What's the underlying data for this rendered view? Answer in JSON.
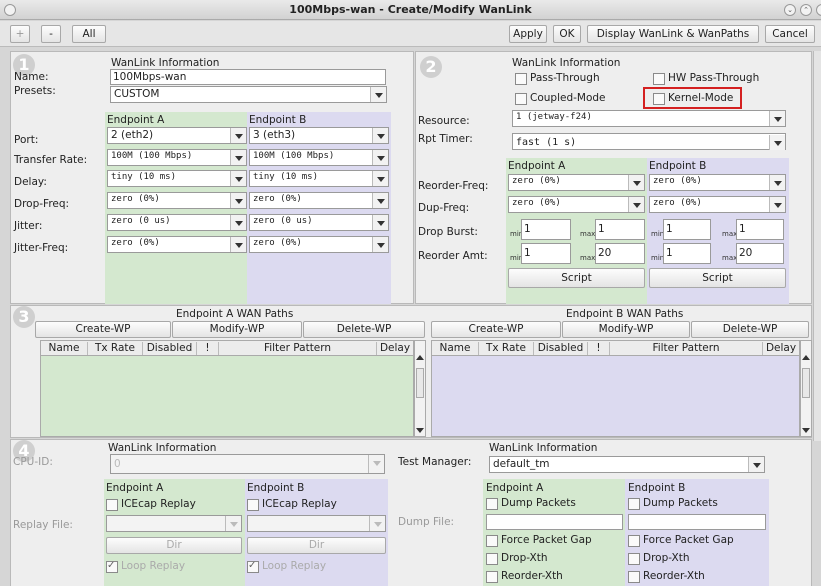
{
  "window": {
    "title": "100Mbps-wan - Create/Modify WanLink"
  },
  "toolbar": {
    "plus": "+",
    "minus": "-",
    "all": "All",
    "apply": "Apply",
    "ok": "OK",
    "display": "Display WanLink & WanPaths",
    "cancel": "Cancel"
  },
  "panel1": {
    "num": "1",
    "header": "WanLink Information",
    "name_label": "Name:",
    "name_value": "100Mbps-wan",
    "presets_label": "Presets:",
    "presets_value": "CUSTOM",
    "endpoint_a": "Endpoint A",
    "endpoint_b": "Endpoint B",
    "rows": [
      {
        "label": "Port:",
        "a": "2 (eth2)",
        "b": "3 (eth3)"
      },
      {
        "label": "Transfer Rate:",
        "a": "100M    (100 Mbps)",
        "b": "100M    (100 Mbps)"
      },
      {
        "label": "Delay:",
        "a": "tiny (10 ms)",
        "b": "tiny (10 ms)"
      },
      {
        "label": "Drop-Freq:",
        "a": "zero (0%)",
        "b": "zero (0%)"
      },
      {
        "label": "Jitter:",
        "a": "zero (0 us)",
        "b": "zero (0 us)"
      },
      {
        "label": "Jitter-Freq:",
        "a": "zero (0%)",
        "b": "zero (0%)"
      }
    ]
  },
  "panel2": {
    "num": "2",
    "header": "WanLink Information",
    "pass_through": "Pass-Through",
    "hw_pass_through": "HW Pass-Through",
    "coupled_mode": "Coupled-Mode",
    "kernel_mode": "Kernel-Mode",
    "resource_label": "Resource:",
    "resource_value": "1 (jetway-f24)",
    "rpt_timer_label": "Rpt Timer:",
    "rpt_timer_value": "fast     (1 s)",
    "endpoint_a": "Endpoint A",
    "endpoint_b": "Endpoint B",
    "reorder_freq_label": "Reorder-Freq:",
    "reorder_a": "zero (0%)",
    "reorder_b": "zero (0%)",
    "dup_freq_label": "Dup-Freq:",
    "dup_a": "zero (0%)",
    "dup_b": "zero (0%)",
    "drop_burst_label": "Drop Burst:",
    "reorder_amt_label": "Reorder Amt:",
    "min": "min",
    "max": "max",
    "drop_burst": {
      "a_min": "1",
      "a_max": "1",
      "b_min": "1",
      "b_max": "1"
    },
    "reorder_amt": {
      "a_min": "1",
      "a_max": "20",
      "b_min": "1",
      "b_max": "20"
    },
    "script": "Script"
  },
  "panel3": {
    "num": "3",
    "a_title": "Endpoint A WAN Paths",
    "b_title": "Endpoint B WAN Paths",
    "create": "Create-WP",
    "modify": "Modify-WP",
    "delete": "Delete-WP",
    "columns": [
      "Name",
      "Tx Rate",
      "Disabled",
      "!",
      "Filter Pattern",
      "Delay"
    ]
  },
  "panel4": {
    "num": "4",
    "header_left": "WanLink Information",
    "cpu_id_label": "CPU-ID:",
    "cpu_id_value": "0",
    "endpoint_a": "Endpoint A",
    "endpoint_b": "Endpoint B",
    "icecap": "ICEcap Replay",
    "replay_file_label": "Replay File:",
    "dir": "Dir",
    "loop_replay": "Loop Replay",
    "header_right": "WanLink Information",
    "test_manager_label": "Test Manager:",
    "test_manager_value": "default_tm",
    "dump_packets": "Dump Packets",
    "dump_file_label": "Dump File:",
    "force_gap": "Force Packet Gap",
    "drop_xth": "Drop-Xth",
    "reorder_xth": "Reorder-Xth"
  }
}
